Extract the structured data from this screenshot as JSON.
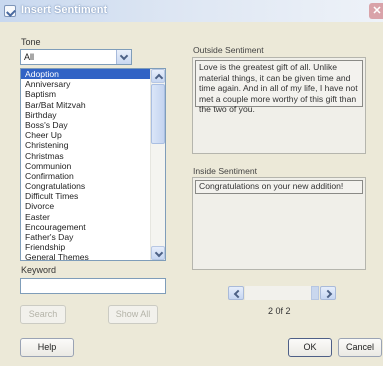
{
  "window": {
    "title": "Insert Sentiment",
    "close_label": "✕"
  },
  "tone": {
    "label": "Tone",
    "selected": "All",
    "items": [
      "Adoption",
      "Anniversary",
      "Baptism",
      "Bar/Bat Mitzvah",
      "Birthday",
      "Boss's Day",
      "Cheer Up",
      "Christening",
      "Christmas",
      "Communion",
      "Confirmation",
      "Congratulations",
      "Difficult Times",
      "Divorce",
      "Easter",
      "Encouragement",
      "Father's Day",
      "Friendship",
      "General Themes"
    ]
  },
  "keyword": {
    "label": "Keyword",
    "value": ""
  },
  "buttons": {
    "search": "Search",
    "show_all": "Show All",
    "help": "Help",
    "ok": "OK",
    "cancel": "Cancel"
  },
  "outside": {
    "label": "Outside Sentiment",
    "text": "Love is the greatest gift of all. Unlike material things, it can be given time and time again. And in all of my life, I have not met a couple more worthy of this gift than the two of you."
  },
  "inside": {
    "label": "Inside Sentiment",
    "text": "Congratulations on your new addition!"
  },
  "pager": {
    "indicator": "2 0f 2"
  },
  "colors": {
    "selection": "#3163c5",
    "title_gradient": "#c8d8ef",
    "close": "#d9a3a9"
  }
}
